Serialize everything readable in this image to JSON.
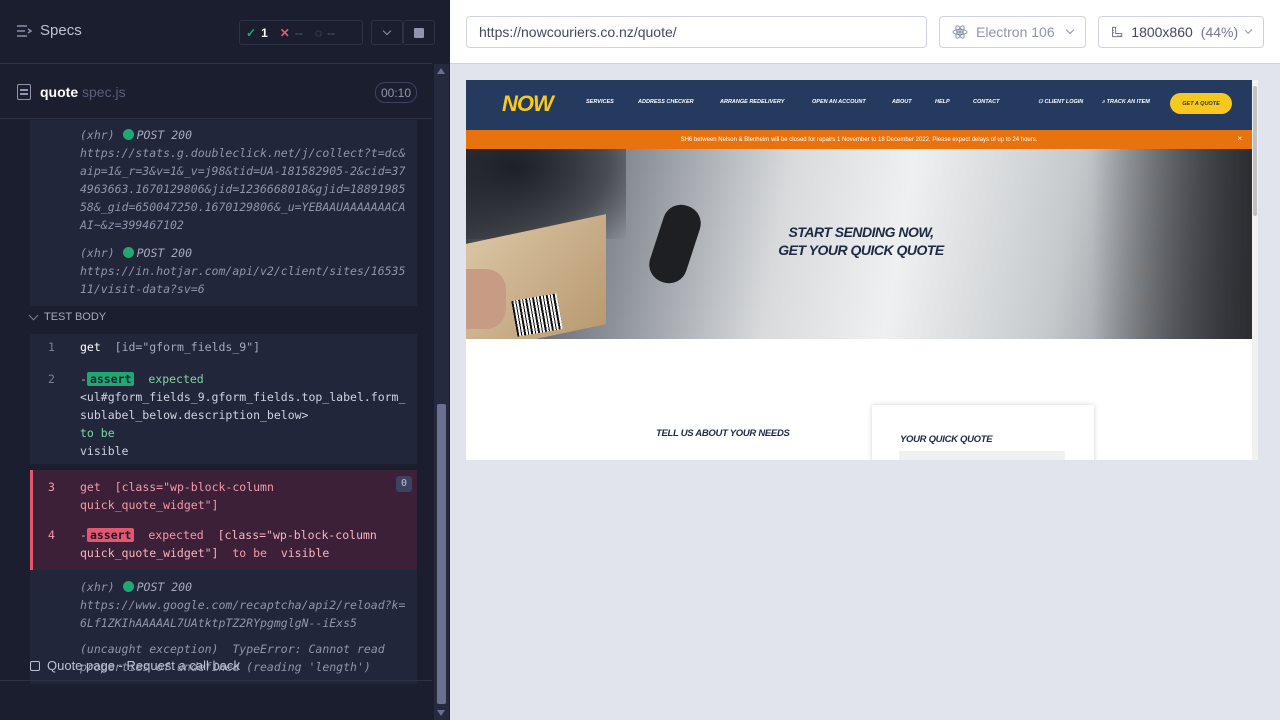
{
  "reporter": {
    "specs_label": "Specs",
    "stats": {
      "passed": "1",
      "failed": "--",
      "pending": "--"
    },
    "spec": {
      "name": "quote",
      "ext": "spec.js",
      "timer": "00:10"
    },
    "logs_top": [
      {
        "type": "(xhr)",
        "method": "POST 200",
        "url": "https://stats.g.doubleclick.net/j/collect?t=dc&aip=1&_r=3&v=1&_v=j98&tid=UA-181582905-2&cid=374963663.1670129806&jid=1236668018&gjid=1889198558&_gid=650047250.1670129806&_u=YEBAAUAAAAAAACAAI~&z=399467102"
      },
      {
        "type": "(xhr)",
        "method": "POST 200",
        "url": "https://in.hotjar.com/api/v2/client/sites/1653511/visit-data?sv=6"
      }
    ],
    "test_body_label": "TEST BODY",
    "commands": [
      {
        "num": "1",
        "name": "get",
        "selector": "[id=\"gform_fields_9\"]"
      },
      {
        "num": "2",
        "name": "-assert",
        "badge": "assert",
        "text1": "expected",
        "text2": "<ul#gform_fields_9.gform_fields.top_label.form_sublabel_below.description_below>",
        "text3": "to be",
        "text4": "visible"
      },
      {
        "num": "3",
        "name": "get",
        "selector": "[class=\"wp-block-column quick_quote_widget\"]",
        "count": "0"
      },
      {
        "num": "4",
        "badge": "assert",
        "text1": "expected",
        "text2": "[class=\"wp-block-column quick_quote_widget\"]",
        "text3": "to be",
        "text4": "visible"
      }
    ],
    "logs_bottom": [
      {
        "type": "(xhr)",
        "method": "POST 200",
        "url": "https://www.google.com/recaptcha/api2/reload?k=6Lf1ZKIhAAAAAL7UAtktpTZ2RYpgmglgN--iExs5"
      },
      {
        "type": "(uncaught exception)",
        "message": "TypeError: Cannot read properties of undefined (reading 'length')"
      }
    ],
    "other_test": "Quote page - Request a call back"
  },
  "aut": {
    "url": "https://nowcouriers.co.nz/quote/",
    "browser": "Electron 106",
    "viewport": "1800x860",
    "viewport_scale": "(44%)"
  },
  "site": {
    "logo": "NOW",
    "nav": [
      "SERVICES",
      "ADDRESS CHECKER",
      "ARRANGE REDELIVERY",
      "OPEN AN ACCOUNT",
      "ABOUT",
      "HELP",
      "CONTACT"
    ],
    "client_login": "CLIENT LOGIN",
    "track_item": "TRACK AN ITEM",
    "get_quote": "GET A QUOTE",
    "alert": "SH6 between Nelson & Blenheim will be closed for repairs 1 November to 18 December 2022. Please expect delays of up to 24 hours.",
    "alert_close": "×",
    "hero_line1": "START SENDING NOW,",
    "hero_line2": "GET YOUR QUICK QUOTE",
    "needs_title": "TELL US ABOUT YOUR NEEDS",
    "quote_title": "YOUR QUICK QUOTE"
  }
}
